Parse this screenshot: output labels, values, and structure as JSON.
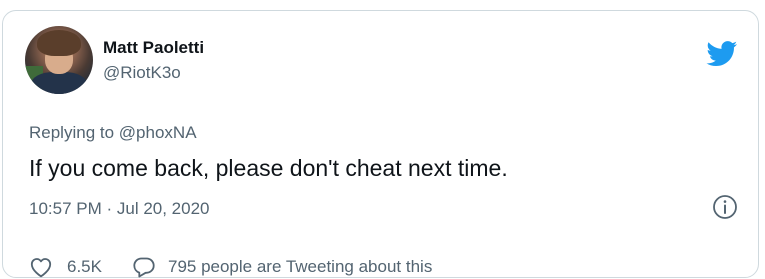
{
  "tweet": {
    "author_name": "Matt Paoletti",
    "author_handle": "@RiotK3o",
    "replying_prefix": "Replying to",
    "replying_to": "@phoxNA",
    "text": "If you come back, please don't cheat next time.",
    "timestamp": "10:57 PM · Jul 20, 2020",
    "like_count": "6.5K",
    "tweeting_about": "795 people are Tweeting about this"
  },
  "icons": {
    "brand": "twitter-bird-icon",
    "info": "info-icon",
    "like": "heart-icon",
    "conversation": "speech-bubble-icon"
  },
  "colors": {
    "brand_blue": "#1d9bf0",
    "text_primary": "#0f1419",
    "text_secondary": "#536471",
    "border": "#cfd9de"
  }
}
